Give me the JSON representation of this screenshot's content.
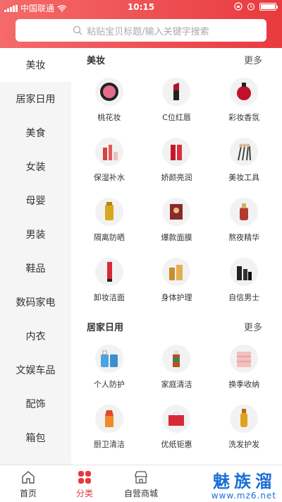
{
  "status_bar": {
    "carrier": "中国联通",
    "time": "10:15"
  },
  "search": {
    "placeholder": "粘贴宝贝标题/输入关键字搜索"
  },
  "sidebar": {
    "items": [
      {
        "label": "美妆"
      },
      {
        "label": "居家日用"
      },
      {
        "label": "美食"
      },
      {
        "label": "女装"
      },
      {
        "label": "母婴"
      },
      {
        "label": "男装"
      },
      {
        "label": "鞋品"
      },
      {
        "label": "数码家电"
      },
      {
        "label": "内衣"
      },
      {
        "label": "文娱车品"
      },
      {
        "label": "配饰"
      },
      {
        "label": "箱包"
      }
    ],
    "active_index": 0
  },
  "sections": [
    {
      "title": "美妆",
      "more": "更多",
      "items": [
        {
          "label": "桃花妆",
          "icon": "blush-compact-icon"
        },
        {
          "label": "C位红唇",
          "icon": "lipstick-icon"
        },
        {
          "label": "彩妆香氛",
          "icon": "perfume-icon"
        },
        {
          "label": "保湿补水",
          "icon": "skincare-bottles-icon"
        },
        {
          "label": "娇颜亮润",
          "icon": "serum-bottles-icon"
        },
        {
          "label": "美妆工具",
          "icon": "makeup-brushes-icon"
        },
        {
          "label": "隔离防晒",
          "icon": "sunscreen-icon"
        },
        {
          "label": "爆款面膜",
          "icon": "face-mask-icon"
        },
        {
          "label": "熬夜精华",
          "icon": "essence-bottle-icon"
        },
        {
          "label": "卸妆洁面",
          "icon": "cleanser-tube-icon"
        },
        {
          "label": "身体护理",
          "icon": "body-lotion-icon"
        },
        {
          "label": "自信男士",
          "icon": "mens-care-icon"
        }
      ]
    },
    {
      "title": "居家日用",
      "more": "更多",
      "items": [
        {
          "label": "个人防护",
          "icon": "hand-sanitizer-icon"
        },
        {
          "label": "家庭清洁",
          "icon": "disinfectant-bottle-icon"
        },
        {
          "label": "换季收纳",
          "icon": "storage-drawer-icon"
        },
        {
          "label": "厨卫清洁",
          "icon": "cleaner-spray-icon"
        },
        {
          "label": "优纸钜惠",
          "icon": "tissue-box-icon"
        },
        {
          "label": "洗发护发",
          "icon": "shampoo-bottle-icon"
        }
      ]
    }
  ],
  "tabbar": {
    "items": [
      {
        "label": "首页",
        "icon": "home-icon"
      },
      {
        "label": "分类",
        "icon": "category-grid-icon"
      },
      {
        "label": "自营商城",
        "icon": "store-icon"
      }
    ],
    "active_index": 1
  },
  "watermark": {
    "text": "魅族溜",
    "url": "www.mz6.net"
  },
  "colors": {
    "accent": "#e8383d",
    "header_gradient_start": "#f56a6a",
    "header_gradient_end": "#e83a3f"
  }
}
